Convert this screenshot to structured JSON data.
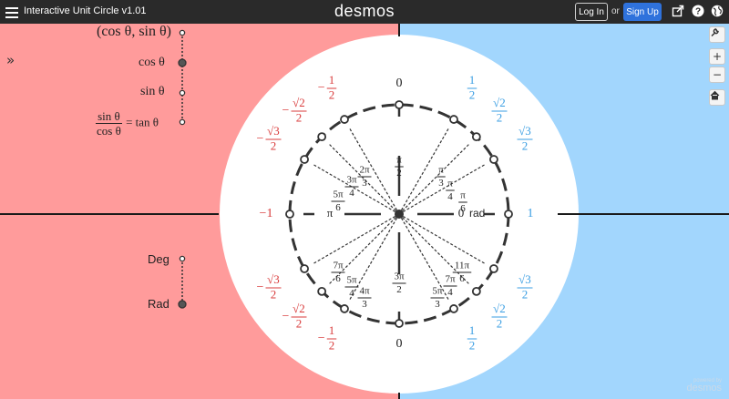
{
  "header": {
    "title": "Interactive Unit Circle v1.01",
    "brand": "desmos",
    "login_label": "Log In",
    "or_text": "or",
    "signup_label": "Sign Up",
    "icons": [
      "share-icon",
      "help-icon",
      "globe-icon"
    ]
  },
  "expressions": {
    "point": "(cos θ, sin θ)",
    "cos": "cos θ",
    "sin": "sin θ",
    "tan_num": "sin θ",
    "tan_den": "cos θ",
    "tan_rhs": "= tan θ",
    "deg": "Deg",
    "rad": "Rad"
  },
  "controls": {
    "zoom_in": "+",
    "zoom_out": "−",
    "icons": [
      "wrench-icon",
      "zoom-in-icon",
      "zoom-out-icon",
      "home-icon"
    ]
  },
  "unit_circle": {
    "axis_top": "0",
    "axis_bottom": "0",
    "axis_left": "−1",
    "axis_right": "1",
    "pi_label": "π",
    "zero_label": "0",
    "rad_label": "rad",
    "radian_labels": [
      {
        "num": "π",
        "den": "2"
      },
      {
        "num": "π",
        "den": "3"
      },
      {
        "num": "π",
        "den": "4"
      },
      {
        "num": "π",
        "den": "6"
      },
      {
        "num": "2π",
        "den": "3"
      },
      {
        "num": "3π",
        "den": "4"
      },
      {
        "num": "5π",
        "den": "6"
      },
      {
        "num": "7π",
        "den": "6"
      },
      {
        "num": "5π",
        "den": "4"
      },
      {
        "num": "4π",
        "den": "3"
      },
      {
        "num": "3π",
        "den": "2"
      },
      {
        "num": "5π",
        "den": "3"
      },
      {
        "num": "7π",
        "den": "4"
      },
      {
        "num": "11π",
        "den": "6"
      }
    ],
    "sin_labels": [
      {
        "sign": "",
        "num": "1",
        "den": "2",
        "side": "right",
        "half": "top"
      },
      {
        "sign": "",
        "num": "√2",
        "den": "2",
        "side": "right",
        "half": "top"
      },
      {
        "sign": "",
        "num": "√3",
        "den": "2",
        "side": "right",
        "half": "top"
      },
      {
        "sign": "−",
        "num": "1",
        "den": "2",
        "side": "left",
        "half": "top"
      },
      {
        "sign": "−",
        "num": "√2",
        "den": "2",
        "side": "left",
        "half": "top"
      },
      {
        "sign": "−",
        "num": "√3",
        "den": "2",
        "side": "left",
        "half": "top"
      },
      {
        "sign": "−",
        "num": "√3",
        "den": "2",
        "side": "left",
        "half": "bottom"
      },
      {
        "sign": "−",
        "num": "√2",
        "den": "2",
        "side": "left",
        "half": "bottom"
      },
      {
        "sign": "−",
        "num": "1",
        "den": "2",
        "side": "left",
        "half": "bottom"
      },
      {
        "sign": "",
        "num": "√3",
        "den": "2",
        "side": "right",
        "half": "bottom"
      },
      {
        "sign": "",
        "num": "√2",
        "den": "2",
        "side": "right",
        "half": "bottom"
      },
      {
        "sign": "",
        "num": "1",
        "den": "2",
        "side": "right",
        "half": "bottom"
      }
    ]
  },
  "footer": {
    "powered_by": "powered by",
    "powered_brand": "desmos"
  },
  "colors": {
    "left_bg": "#ff9b9b",
    "right_bg": "#a2d6fd",
    "negative": "#d93b3b",
    "positive": "#3a9ee3",
    "ink": "#222222",
    "circle": "#333333"
  }
}
